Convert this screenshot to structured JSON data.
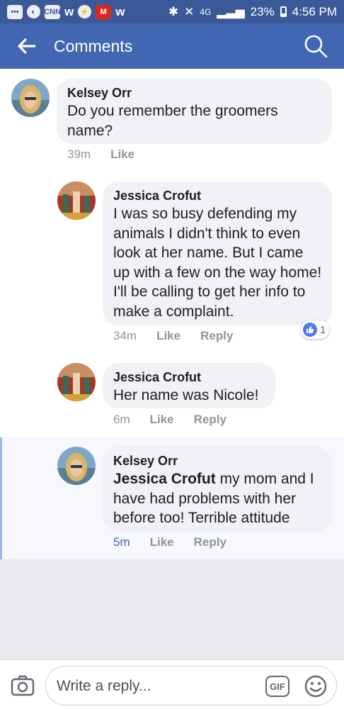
{
  "status_bar": {
    "notification_icons": [
      "chat-icon",
      "cnn-icon",
      "w-icon",
      "messenger-icon",
      "m-icon",
      "w-icon"
    ],
    "signal_text": "4G",
    "battery": "23%",
    "time": "4:56 PM"
  },
  "header": {
    "title": "Comments"
  },
  "comments": [
    {
      "author": "Kelsey Orr",
      "text": "Do you remember the groomers name?",
      "time": "39m",
      "like_label": "Like"
    },
    {
      "author": "Jessica Crofut",
      "text": "I was so busy defending my animals I didn't think to even look at her name. But I came up with a few on the way home! I'll be calling to get her info to make a complaint.",
      "time": "34m",
      "like_label": "Like",
      "reply_label": "Reply",
      "reaction_count": "1"
    },
    {
      "author": "Jessica Crofut",
      "text": "Her name was Nicole!",
      "time": "6m",
      "like_label": "Like",
      "reply_label": "Reply"
    },
    {
      "author": "Kelsey Orr",
      "mention": "Jessica Crofut",
      "text": " my mom and I have had problems with her before too! Terrible attitude",
      "time": "5m",
      "like_label": "Like",
      "reply_label": "Reply"
    }
  ],
  "composer": {
    "placeholder": "Write a reply...",
    "gif_label": "GIF"
  },
  "colors": {
    "status_bar": "#3b5998",
    "header": "#4267b2",
    "bubble": "#f0f2f5",
    "meta_text": "#90949c"
  }
}
